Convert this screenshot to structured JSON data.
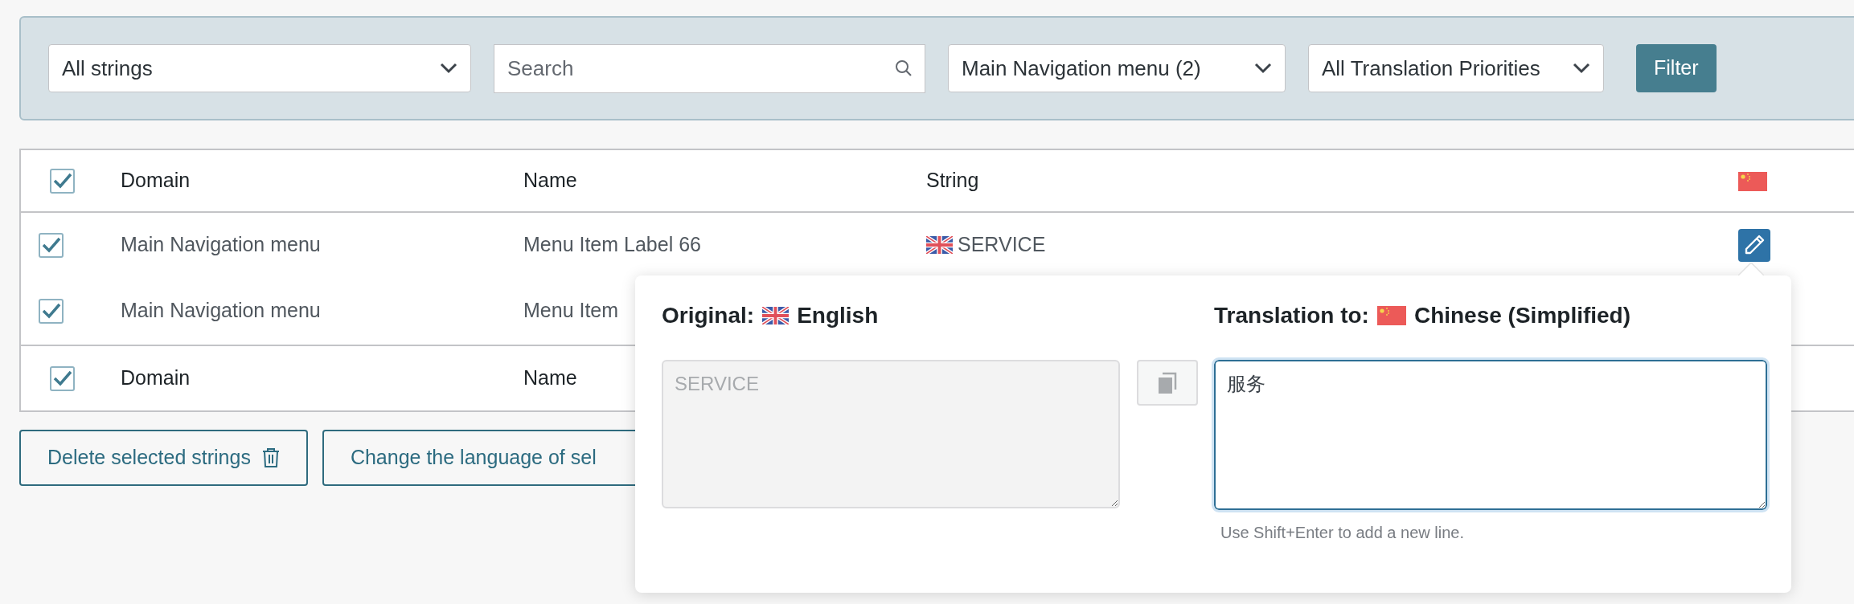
{
  "filters": {
    "selects": [
      {
        "value": "All strings"
      },
      {
        "value": "Main Navigation menu (2)"
      },
      {
        "value": "All Translation Priorities"
      }
    ],
    "search": {
      "placeholder": "Search"
    },
    "filter_button": "Filter"
  },
  "table": {
    "header": {
      "checked": true,
      "columns": [
        "Domain",
        "Name",
        "String"
      ]
    },
    "rows": [
      {
        "checked": true,
        "domain": "Main Navigation menu",
        "name": "Menu Item Label 66",
        "string": "SERVICE",
        "editing": true
      },
      {
        "checked": true,
        "domain": "Main Navigation menu",
        "name": "Menu Item",
        "editing": false
      }
    ],
    "footer": {
      "checked": true,
      "columns": [
        "Domain",
        "Name"
      ]
    }
  },
  "actions": [
    "Delete selected strings",
    "Change the language of sel"
  ],
  "popup": {
    "original": {
      "label": "Original:",
      "language": "English",
      "value": "SERVICE"
    },
    "translation": {
      "label": "Translation to:",
      "language": "Chinese (Simplified)",
      "value": "服务",
      "hint": "Use Shift+Enter to add a new line."
    }
  }
}
